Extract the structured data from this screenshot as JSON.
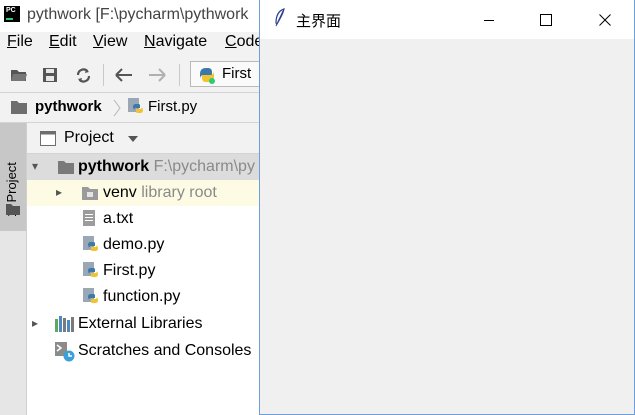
{
  "ide": {
    "title": "pythwork [F:\\pycharm\\pythwork",
    "menu": [
      "File",
      "Edit",
      "View",
      "Navigate",
      "Code"
    ],
    "menu_mnemonics": [
      "F",
      "E",
      "V",
      "N",
      "C"
    ],
    "run_config": "First",
    "breadcrumb": [
      "pythwork",
      "First.py"
    ],
    "side_tab": "1: Project",
    "project_panel": {
      "title": "Project",
      "root": {
        "name": "pythwork",
        "path": "F:\\pycharm\\py"
      },
      "items": [
        {
          "name": "venv",
          "note": "library root",
          "kind": "folder"
        },
        {
          "name": "a.txt",
          "kind": "text"
        },
        {
          "name": "demo.py",
          "kind": "python"
        },
        {
          "name": "First.py",
          "kind": "python"
        },
        {
          "name": "function.py",
          "kind": "python"
        }
      ],
      "external": "External Libraries",
      "scratches": "Scratches and Consoles"
    },
    "colors": {
      "accent": "#6f9fd8",
      "python_blue": "#3c78aa",
      "python_yellow": "#f2c230"
    }
  },
  "tk": {
    "title": "主界面"
  }
}
